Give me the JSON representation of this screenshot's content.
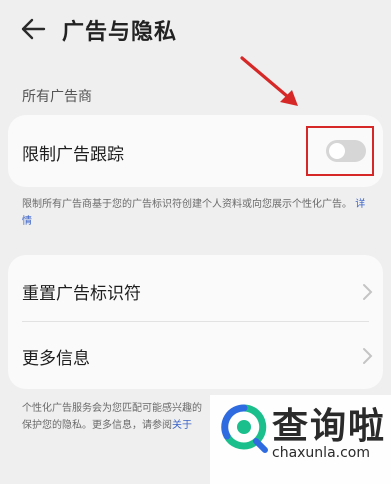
{
  "header": {
    "title": "广告与隐私"
  },
  "section": {
    "title": "所有广告商"
  },
  "limit_ad_tracking": {
    "label": "限制广告跟踪",
    "enabled": false
  },
  "description": {
    "text": "限制所有广告商基于您的广告标识符创建个人资料或向您展示个性化广告。",
    "link": "详情"
  },
  "rows": [
    {
      "label": "重置广告标识符"
    },
    {
      "label": "更多信息"
    }
  ],
  "footer": {
    "line1": "个性化广告服务会为您匹配可能感兴趣的",
    "line2": "保护您的隐私。更多信息，请参阅",
    "link": "关于"
  },
  "watermark": {
    "title": "查询啦",
    "url": "chaxunla.com"
  },
  "colors": {
    "accent_red": "#d72828",
    "link_blue": "#3a62c7",
    "watermark_green": "#1bbf8b",
    "watermark_blue": "#2f6be0"
  }
}
